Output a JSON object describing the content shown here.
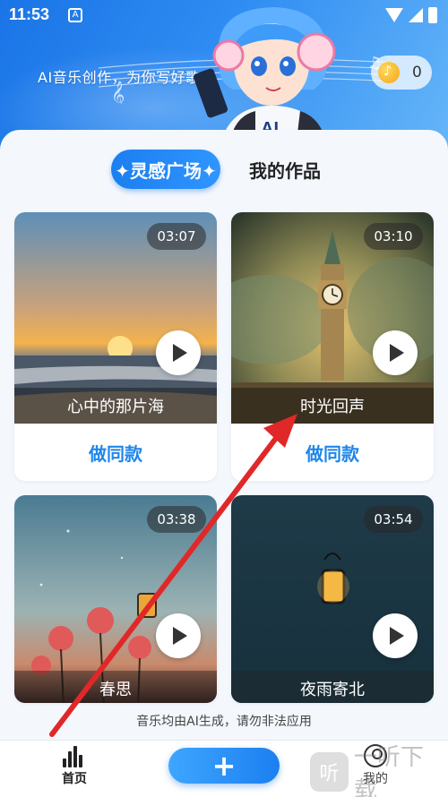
{
  "status": {
    "time": "11:53"
  },
  "header": {
    "slogan": "AI音乐创作，为你写好歌",
    "coins": "0"
  },
  "tabs": {
    "active": "✦灵感广场✦",
    "other": "我的作品"
  },
  "cards": [
    {
      "title": "心中的那片海",
      "duration": "03:07",
      "action": "做同款"
    },
    {
      "title": "时光回声",
      "duration": "03:10",
      "action": "做同款"
    },
    {
      "title": "春思",
      "duration": "03:38"
    },
    {
      "title": "夜雨寄北",
      "duration": "03:54"
    }
  ],
  "disclaimer": "音乐均由AI生成，请勿非法应用",
  "nav": {
    "home": "首页",
    "mine": "我的"
  },
  "watermark": {
    "logo_char": "听",
    "text": "一听下载"
  },
  "colors": {
    "accent": "#1f86ea",
    "arrow": "#e02828"
  }
}
